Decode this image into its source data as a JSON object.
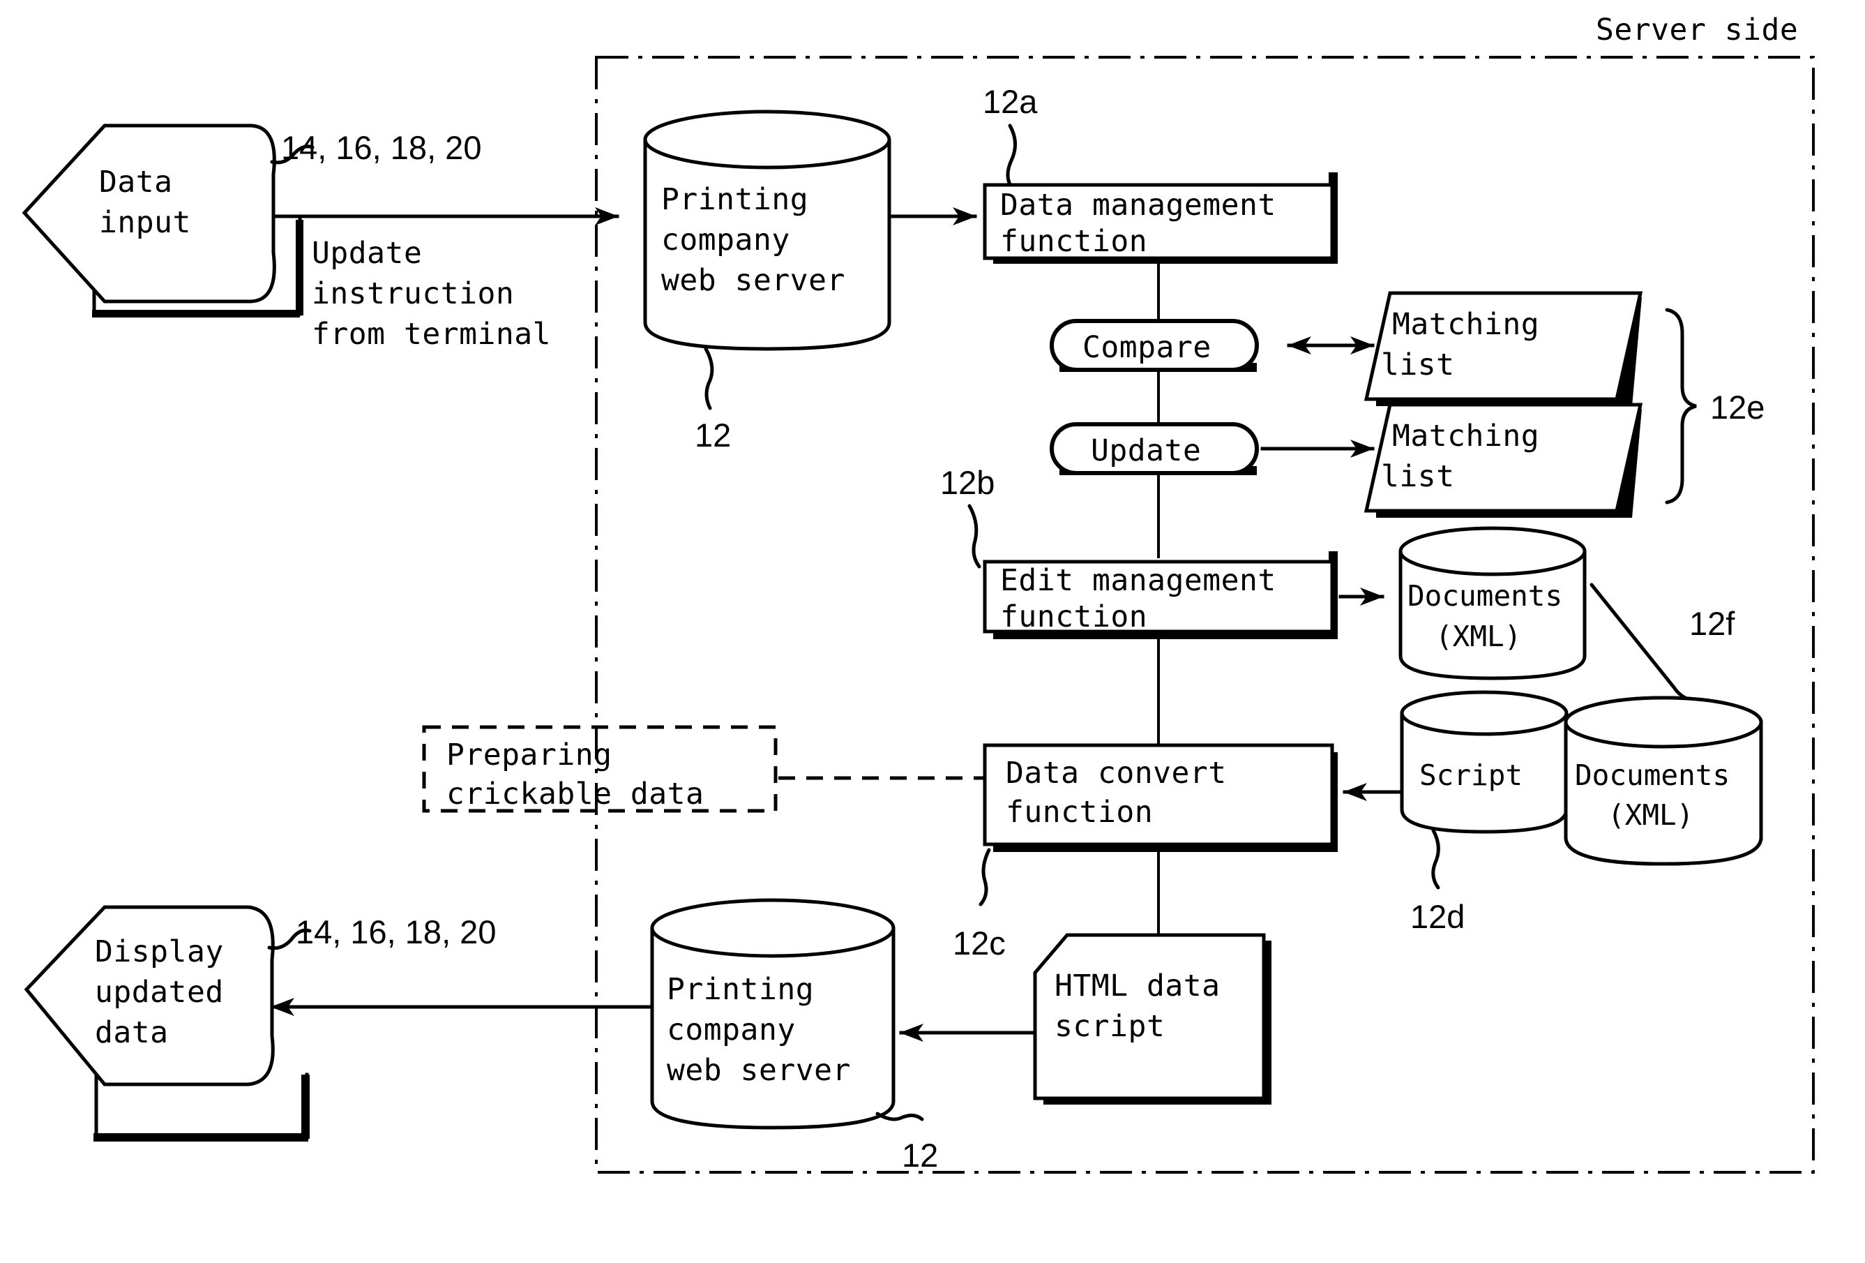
{
  "figure": {
    "title": "Server side",
    "boundary_label": "Server side"
  },
  "nodes": {
    "data_input": {
      "lines": [
        "Data",
        "input"
      ],
      "ref": "14, 16, 18, 20",
      "shape": "display-symbol"
    },
    "update_instruction": {
      "lines": [
        "Update",
        "instruction",
        "from terminal"
      ],
      "shape": "annotation-text"
    },
    "web_server_top": {
      "lines": [
        "Printing",
        "company",
        "web server"
      ],
      "ref": "12",
      "shape": "cylinder"
    },
    "data_management": {
      "lines": [
        "Data management",
        "function"
      ],
      "ref": "12a",
      "shape": "process-box"
    },
    "compare": {
      "label": "Compare",
      "shape": "stadium"
    },
    "update": {
      "label": "Update",
      "shape": "stadium"
    },
    "matching_list_1": {
      "lines": [
        "Matching",
        "list"
      ],
      "shape": "parallelogram"
    },
    "matching_list_2": {
      "lines": [
        "Matching",
        "list"
      ],
      "shape": "parallelogram"
    },
    "matching_group": {
      "ref": "12e",
      "shape": "brace"
    },
    "edit_management": {
      "lines": [
        "Edit management",
        "function"
      ],
      "ref": "12b",
      "shape": "process-box"
    },
    "documents_xml_top": {
      "lines": [
        "Documents",
        "(XML)"
      ],
      "ref": "12f",
      "shape": "cylinder"
    },
    "preparing_clickable": {
      "lines": [
        "Preparing",
        "crickable data"
      ],
      "shape": "dashed-box"
    },
    "data_convert": {
      "lines": [
        "Data convert",
        "function"
      ],
      "ref": "12c",
      "shape": "process-box"
    },
    "script_db": {
      "label": "Script",
      "ref": "12d",
      "shape": "cylinder"
    },
    "documents_xml_right": {
      "lines": [
        "Documents",
        "(XML)"
      ],
      "shape": "cylinder"
    },
    "html_data_script": {
      "lines": [
        "HTML data",
        "script"
      ],
      "shape": "clipped-box"
    },
    "web_server_bottom": {
      "lines": [
        "Printing",
        "company",
        "web server"
      ],
      "ref": "12",
      "shape": "cylinder"
    },
    "display_updated": {
      "lines": [
        "Display",
        "updated",
        "data"
      ],
      "ref": "14, 16, 18, 20",
      "shape": "display-symbol"
    }
  },
  "colors": {
    "stroke": "#000000",
    "fill": "#ffffff"
  }
}
